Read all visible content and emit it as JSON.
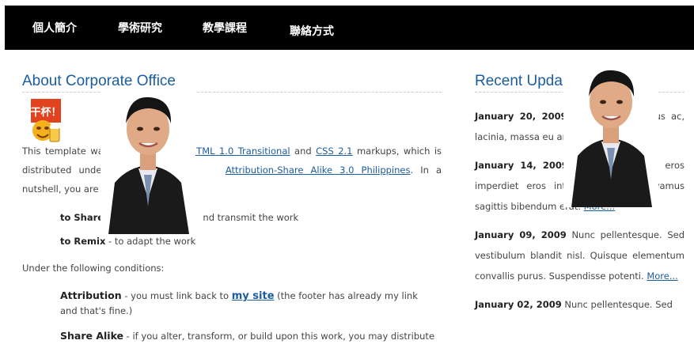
{
  "nav": {
    "items": [
      "個人簡介",
      "學術研究",
      "教學課程",
      "聯絡方式"
    ]
  },
  "main": {
    "heading": "About Corporate Office",
    "sticker_text": "干杯！",
    "para1": {
      "pre": "This template wa",
      "link1": "XHTML 1.0 Transitional",
      "mid1": "and",
      "link2": "CSS 2.1",
      "mid2": "markups, which is distributed under t",
      "link3": "Attribution-Share Alike 3.0 Philippines",
      "post": ". In a nutshell, you are free to:"
    },
    "share": {
      "label": "to Share",
      "text": "nd transmit the work"
    },
    "remix": {
      "label": "to Remix",
      "text": " - to adapt the work"
    },
    "conditions_intro": "Under the following conditions:",
    "attribution": {
      "label": "Attribution",
      "pre": " - you must link back to ",
      "link": "my site",
      "post": " (the footer has already my link and that's fine.)"
    },
    "sharealike": {
      "label": "Share Alike",
      "text": " - if you alter, transform, or build upon this work, you may distribute"
    }
  },
  "side": {
    "heading": "Recent Upda",
    "entries": [
      {
        "date": "January 20, 2009",
        "text": "pit et, rhoncus ac, lacinia, massa eu arcu. Quisque pel",
        "more": "..."
      },
      {
        "date": "January 14, 2009",
        "text": "sem. Sed eu eros imperdiet eros interdum blandit. Vivamus sagittis bibendum erat.",
        "more": "More..."
      },
      {
        "date": "January 09, 2009",
        "text": "Nunc pellentesque. Sed vestibulum blandit nisl. Quisque elementum convallis purus. Suspendisse potenti.",
        "more": "More..."
      },
      {
        "date": "January 02, 2009",
        "text": "Nunc pellentesque. Sed",
        "more": ""
      }
    ]
  },
  "colors": {
    "nav_bg": "#000000",
    "nav_text": "#ffffff",
    "heading": "#1b5da0",
    "link": "#1b5da0",
    "body_text": "#444444"
  },
  "icons": {
    "sticker": "cheers-emoji-sticker",
    "photo": "person-photo"
  }
}
